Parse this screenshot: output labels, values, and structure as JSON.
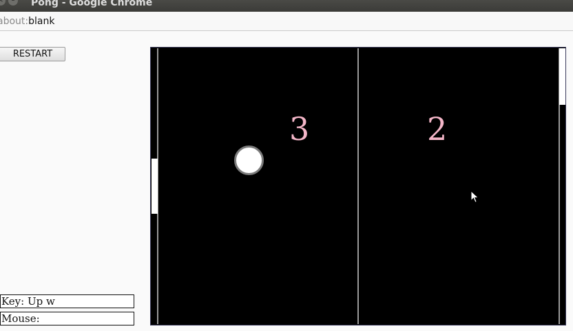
{
  "window": {
    "title": "Pong - Google Chrome",
    "buttons": [
      "close-icon",
      "minimize-icon"
    ]
  },
  "address_bar": {
    "scheme": "about:",
    "path": "blank"
  },
  "controls": {
    "restart_label": "RESTART"
  },
  "game": {
    "score_left": "3",
    "score_right": "2",
    "colors": {
      "field": "#000000",
      "lines": "#9a9a9a",
      "paddles": "#ffffff",
      "ball": "#ffffff",
      "score": "#f4b6c8"
    }
  },
  "status": {
    "key_text": "Key: Up w",
    "mouse_text": "Mouse:"
  }
}
